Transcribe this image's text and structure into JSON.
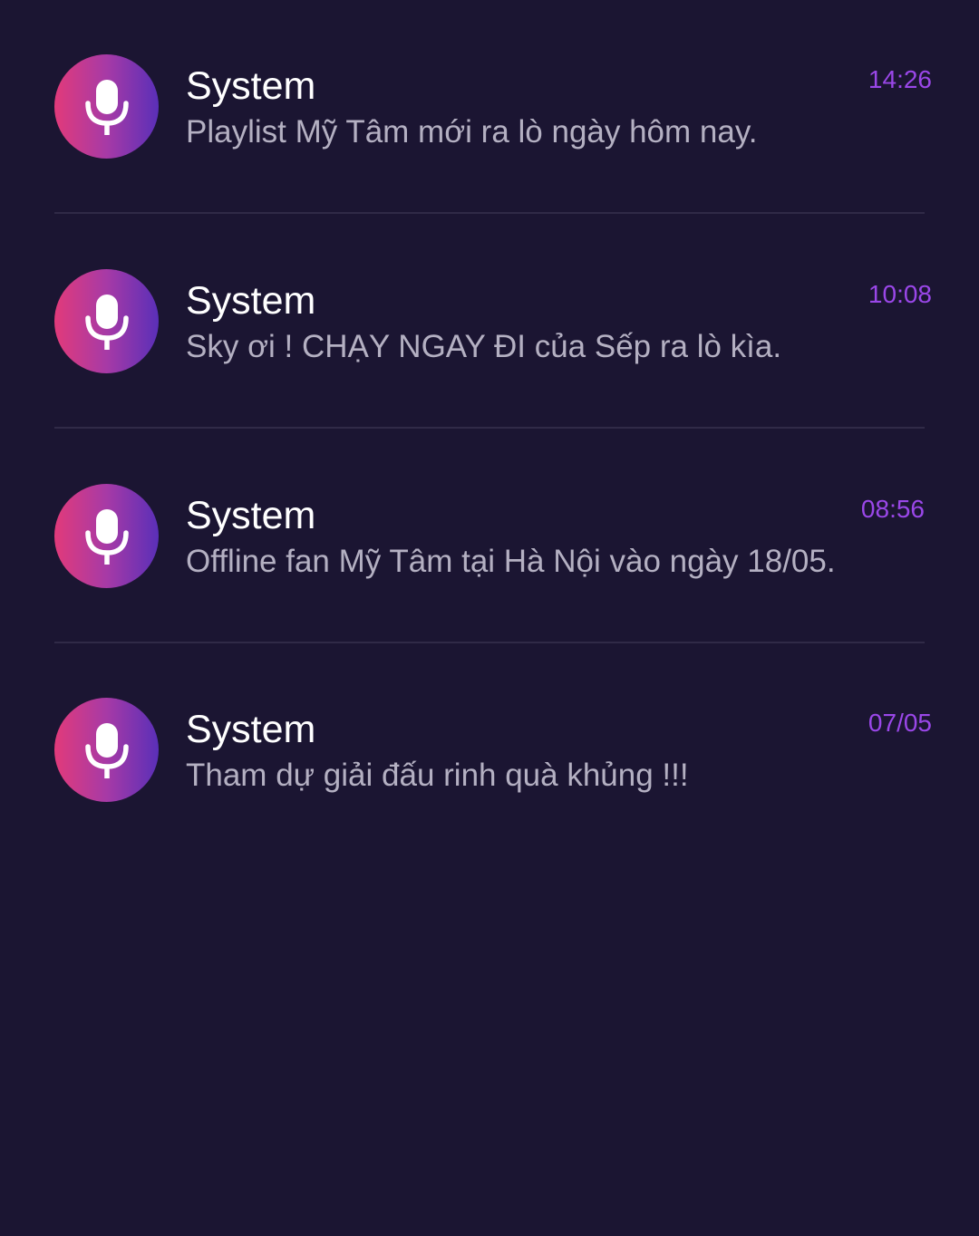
{
  "notifications": [
    {
      "title": "System",
      "message": "Playlist Mỹ Tâm mới ra lò ngày hôm nay.",
      "time": "14:26",
      "icon": "microphone-icon"
    },
    {
      "title": "System",
      "message": "Sky ơi ! CHẠY NGAY ĐI của Sếp ra lò kìa.",
      "time": "10:08",
      "icon": "microphone-icon"
    },
    {
      "title": "System",
      "message": "Offline fan Mỹ Tâm tại Hà Nội vào ngày 18/05.",
      "time": "08:56",
      "icon": "microphone-icon"
    },
    {
      "title": "System",
      "message": "Tham dự giải đấu rinh quà khủng !!!",
      "time": "07/05",
      "icon": "microphone-icon"
    }
  ],
  "colors": {
    "background": "#1b1532",
    "time_accent": "#9a47e8",
    "avatar_gradient_start": "#e23a7a",
    "avatar_gradient_end": "#5a2fb8",
    "divider": "#302a47"
  }
}
